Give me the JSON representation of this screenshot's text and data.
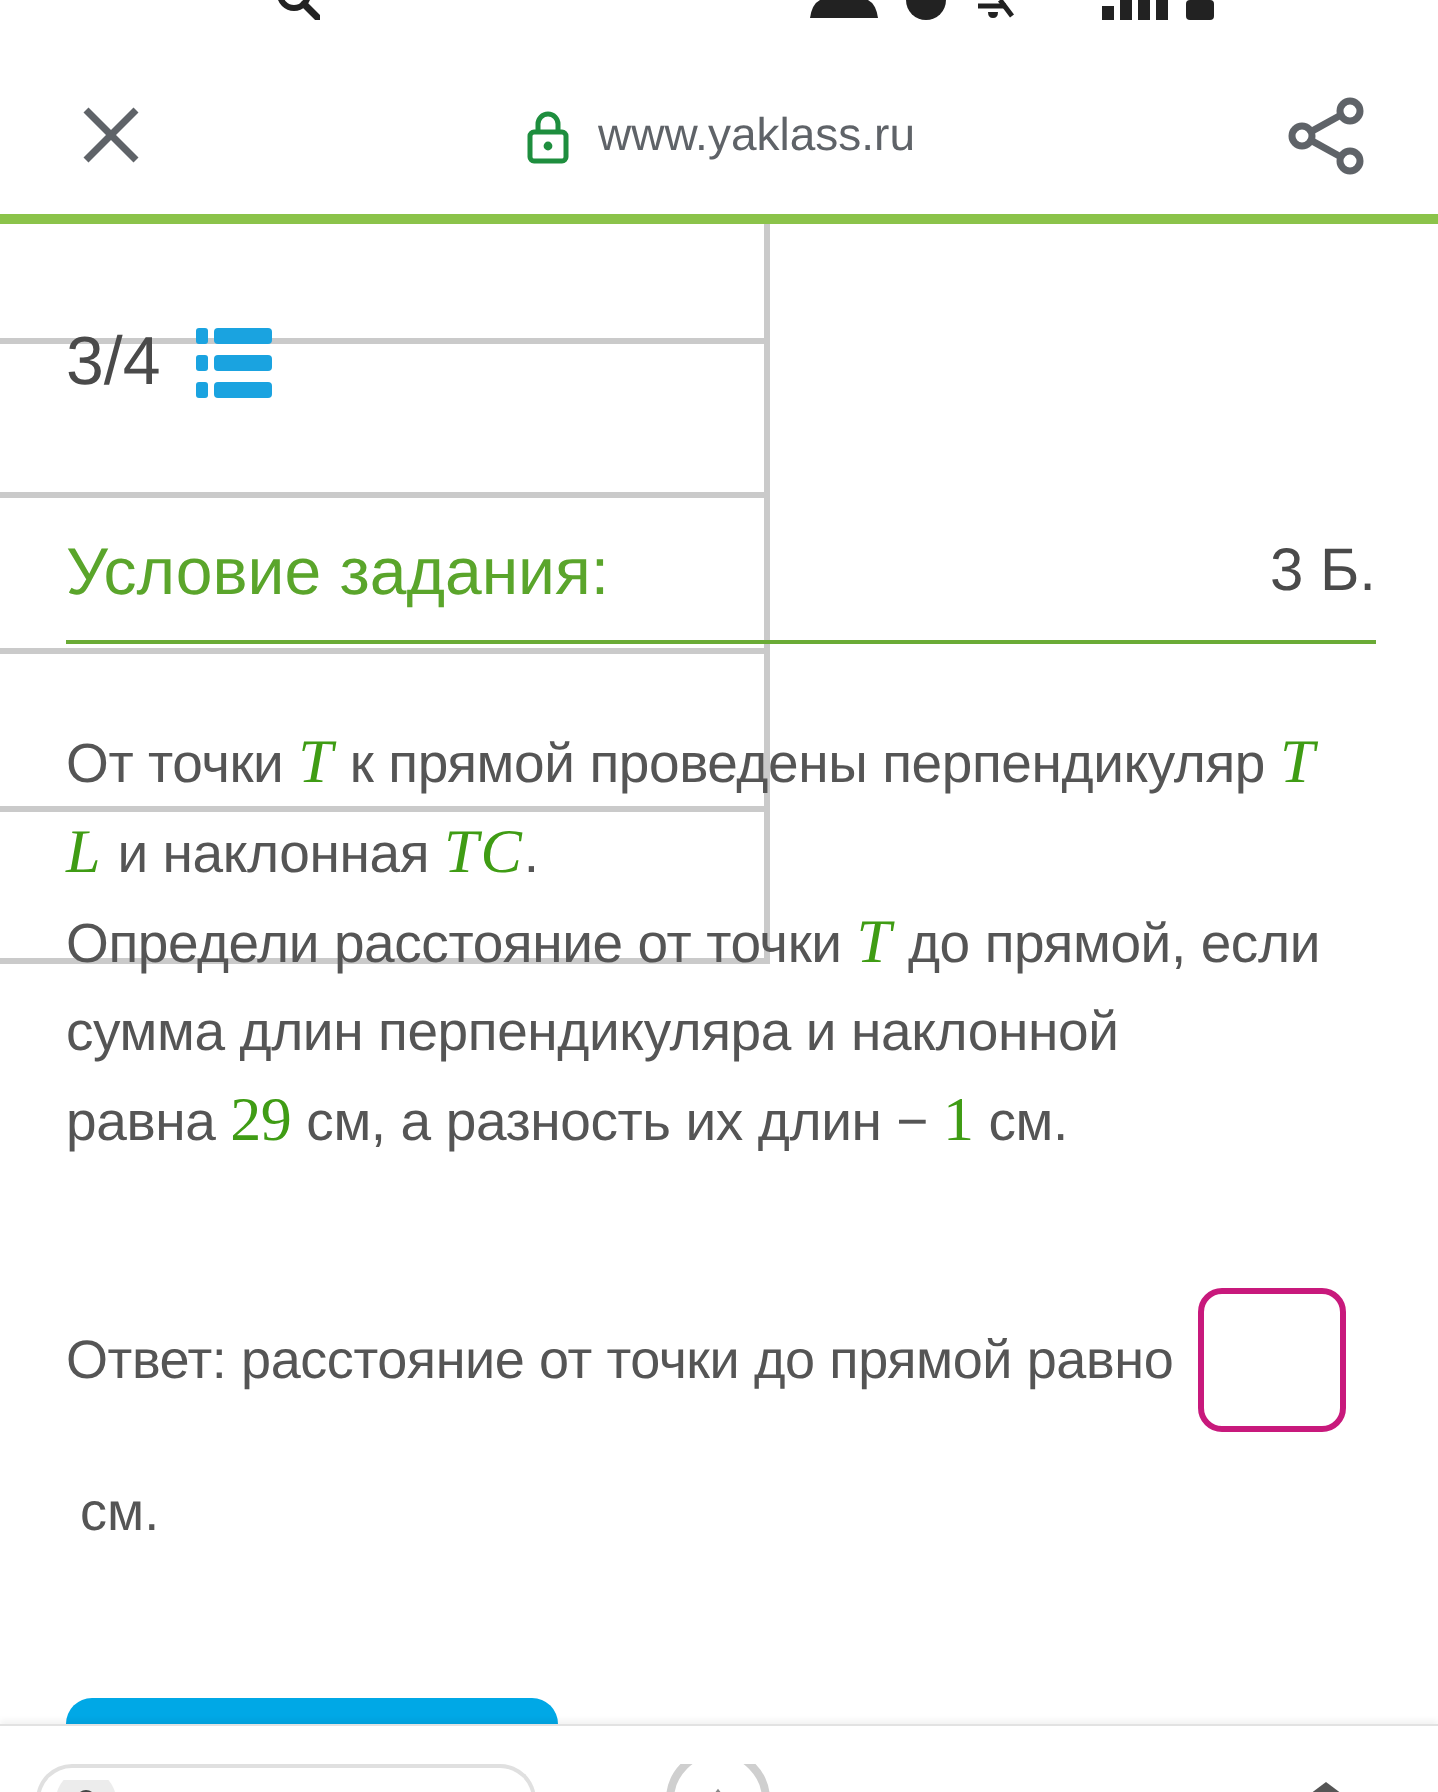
{
  "browser_bar": {
    "url": "www.yaklass.ru"
  },
  "task": {
    "counter": "3/4",
    "title": "Условие задания:",
    "points": "3 Б."
  },
  "problem": {
    "paragraphs": [
      {
        "segments": [
          {
            "kind": "text",
            "text": "От точки "
          },
          {
            "kind": "variable",
            "text": "T"
          },
          {
            "kind": "text",
            "text": " к прямой проведены перпендикуляр "
          },
          {
            "kind": "variable",
            "text": "TL"
          },
          {
            "kind": "text",
            "text": " и наклонная "
          },
          {
            "kind": "variable",
            "text": "TC"
          },
          {
            "kind": "text",
            "text": "."
          }
        ]
      },
      {
        "segments": [
          {
            "kind": "text",
            "text": "Определи расстояние от точки "
          },
          {
            "kind": "variable",
            "text": "T"
          },
          {
            "kind": "text",
            "text": " до прямой, если сумма длин перпендикуляра и наклонной равна "
          },
          {
            "kind": "number",
            "text": "29"
          },
          {
            "kind": "text",
            "text": " см, а разность их длин − "
          },
          {
            "kind": "number",
            "text": "1"
          },
          {
            "kind": "text",
            "text": " см."
          }
        ]
      }
    ]
  },
  "answer": {
    "prompt": "Ответ: расстояние от точки до прямой равно",
    "unit": "см."
  }
}
